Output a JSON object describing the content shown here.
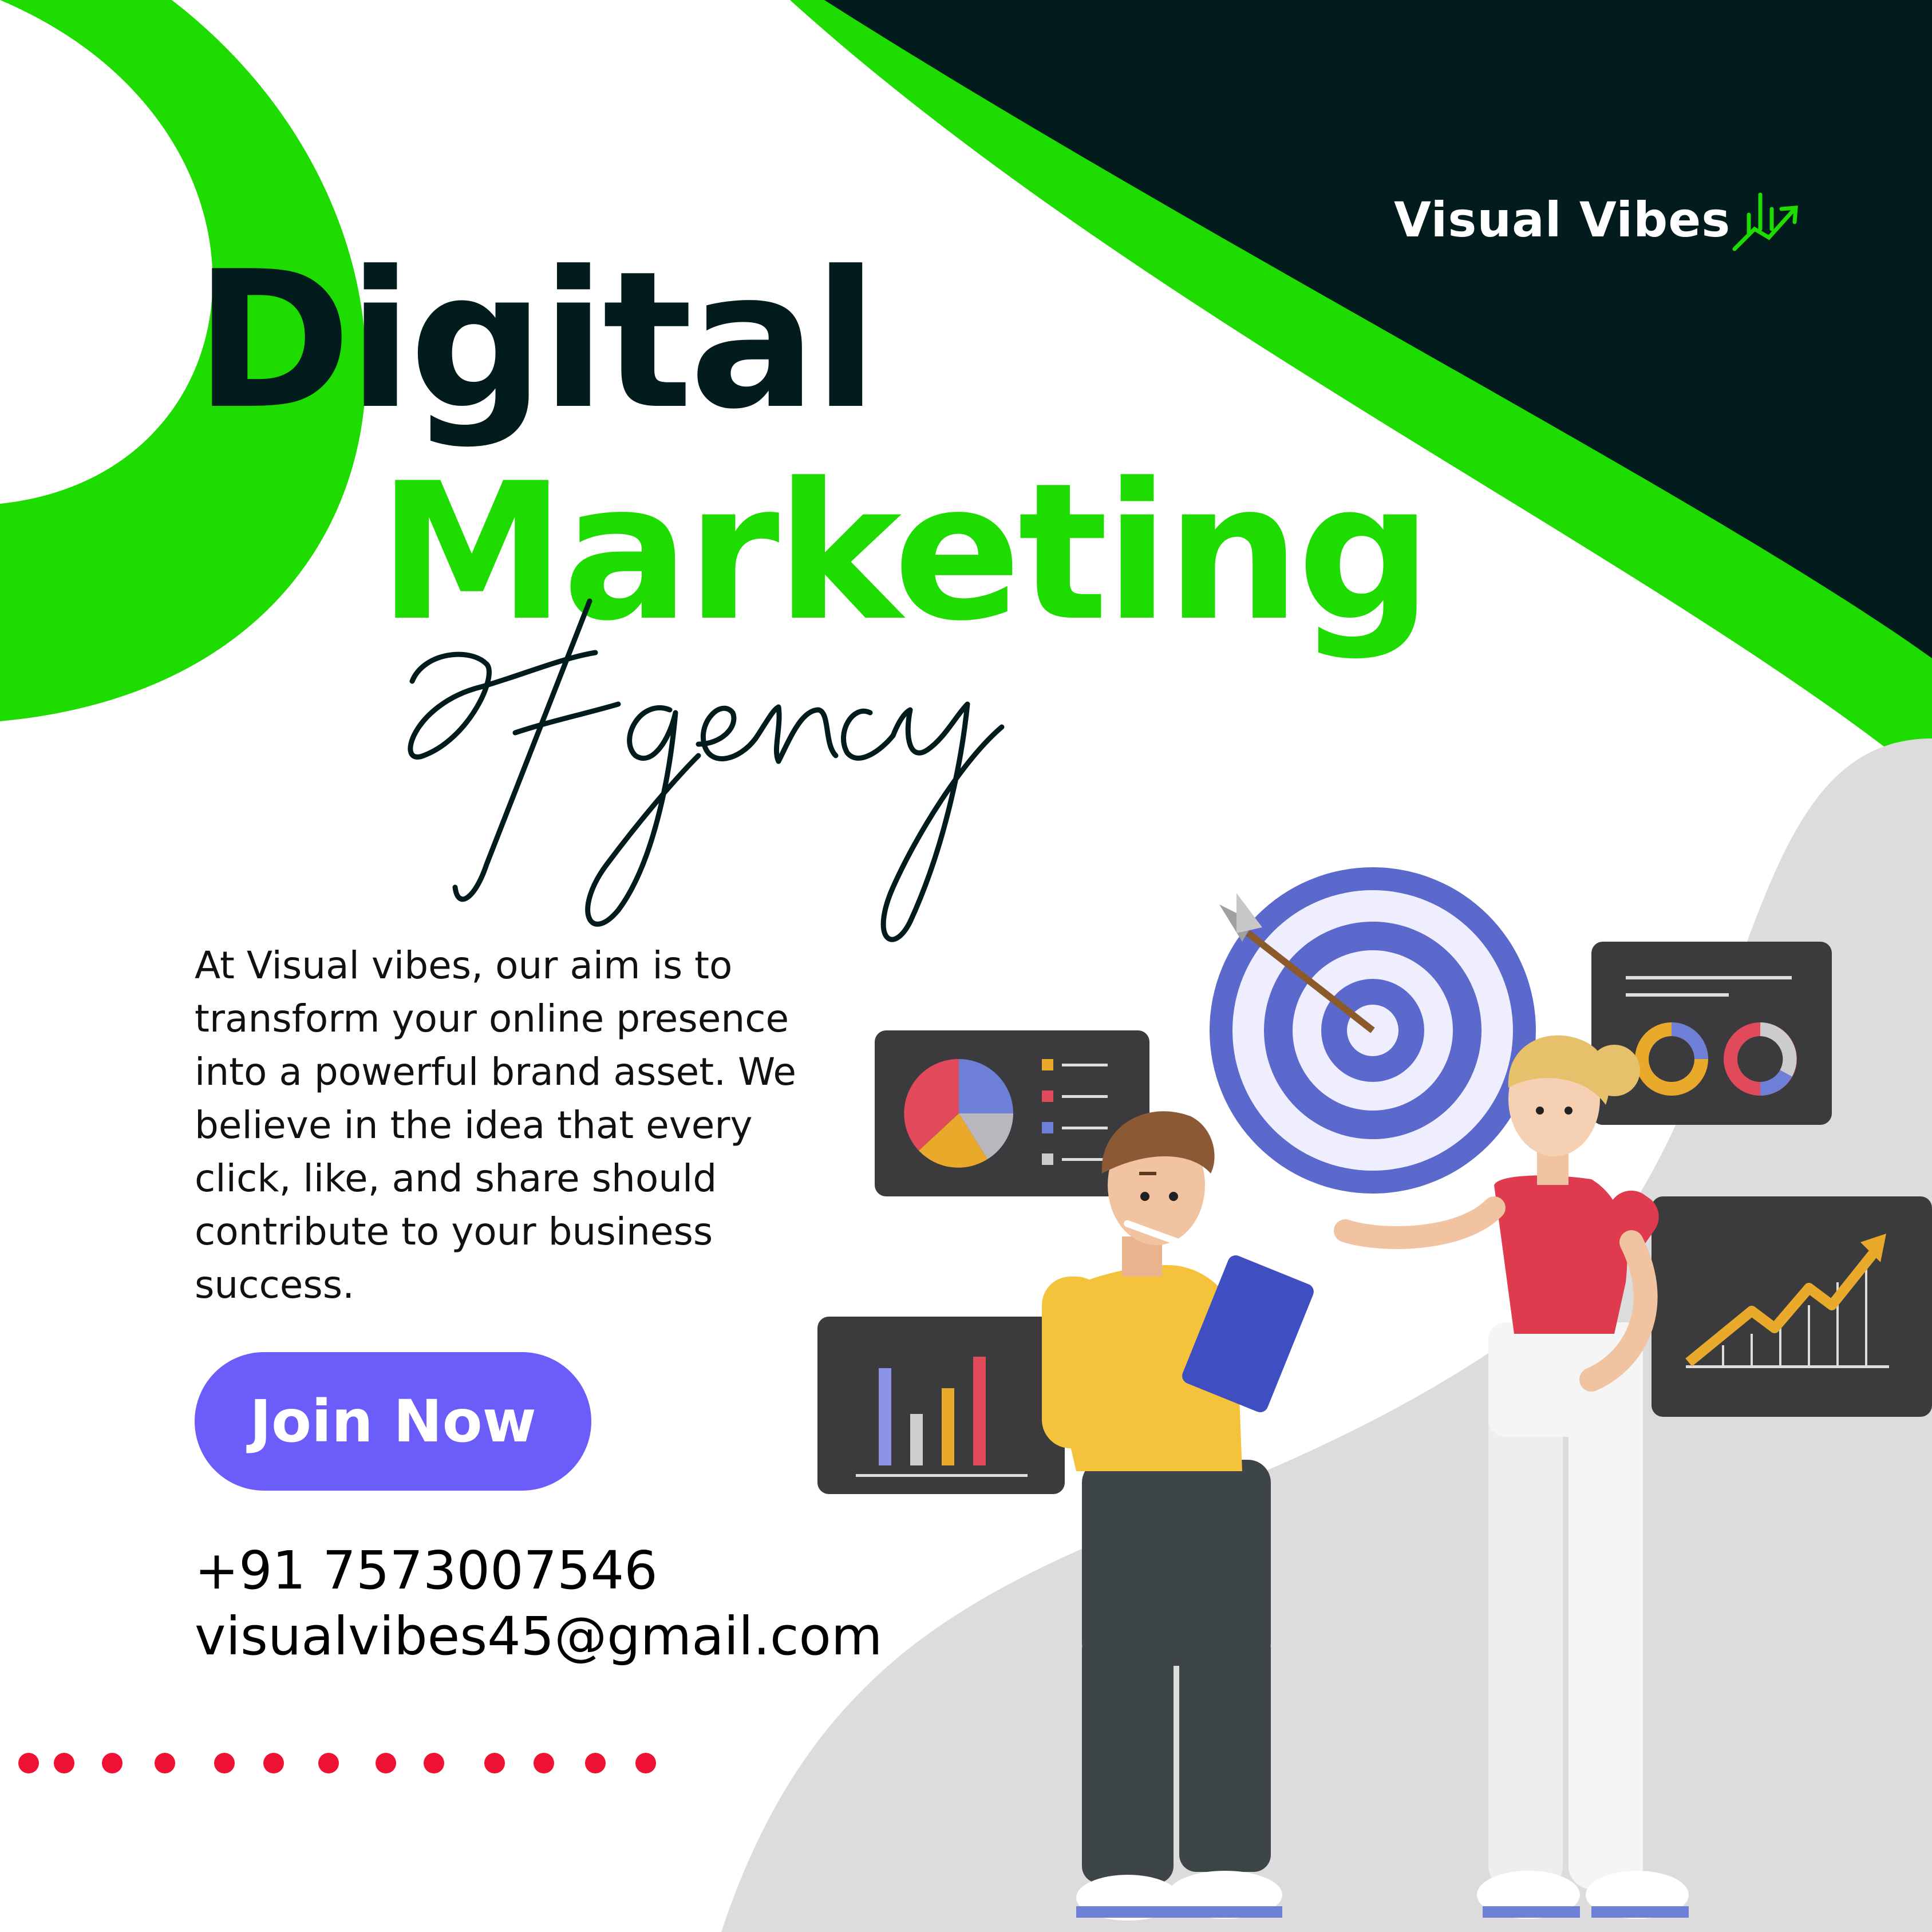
{
  "brand": {
    "name": "Visual Vibes",
    "icon": "growth-chart-icon"
  },
  "headline": {
    "line1": "Digital",
    "line2": "Marketing",
    "script": "Agency"
  },
  "body_text": "At Visual vibes, our aim is to transform your online presence into a powerful brand asset. We believe in the idea that every click, like, and share should contribute to your business success.",
  "cta": {
    "label": "Join Now"
  },
  "contact": {
    "phone": "+91 7573007546",
    "email": "visualvibes45@gmail.com"
  },
  "colors": {
    "accent_green": "#1edc00",
    "dark": "#021c1e",
    "button": "#6c5dfa",
    "dots": "#ee1133",
    "grey": "#dcdcdc"
  },
  "illustration": {
    "icons": [
      "target-icon",
      "arrow-icon",
      "pie-chart-icon",
      "bar-chart-icon",
      "donut-chart-icon",
      "line-chart-icon",
      "man-figure",
      "woman-figure"
    ]
  }
}
